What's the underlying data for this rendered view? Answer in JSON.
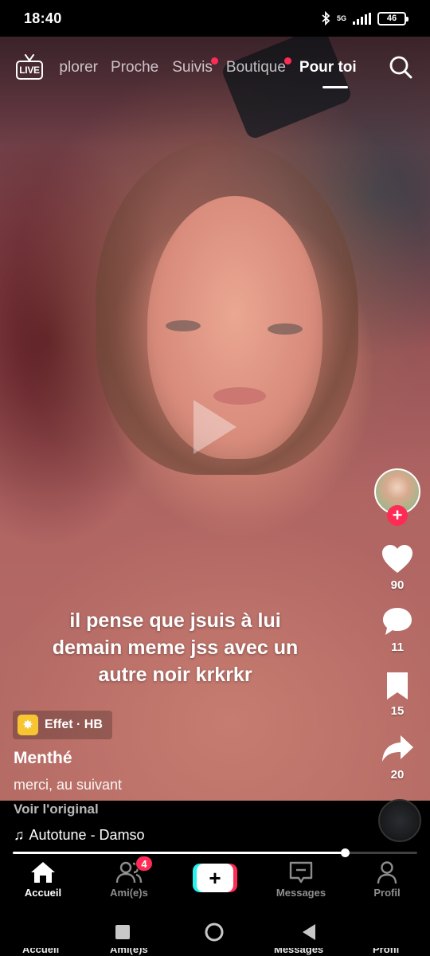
{
  "status_bar": {
    "time": "18:40",
    "network": "5G",
    "battery": "46"
  },
  "top_nav": {
    "live_label": "LIVE",
    "tabs": [
      {
        "label": "Explorer",
        "visible_text": "plorer",
        "active": false,
        "dot": false
      },
      {
        "label": "Proche",
        "active": false,
        "dot": false
      },
      {
        "label": "Suivis",
        "active": false,
        "dot": true
      },
      {
        "label": "Boutique",
        "active": false,
        "dot": true
      },
      {
        "label": "Pour toi",
        "active": true,
        "dot": false
      }
    ]
  },
  "video": {
    "caption_lines": [
      "il pense que jsuis à lui",
      "demain meme jss avec un",
      "autre noir krkrkr"
    ],
    "effect_label": "Effet · HB",
    "username": "Menthé",
    "description": "merci, au suivant",
    "see_original": "Voir l'original",
    "music": "Autotune - Damso",
    "progress": 0.82
  },
  "actions": {
    "likes": "90",
    "comments": "11",
    "saves": "15",
    "shares": "20"
  },
  "bottom_nav": {
    "items": [
      {
        "label": "Accueil",
        "active": true
      },
      {
        "label": "Ami(e)s",
        "active": false,
        "badge": "4"
      },
      {
        "label": "",
        "create": true
      },
      {
        "label": "Messages",
        "active": false
      },
      {
        "label": "Profil",
        "active": false
      }
    ]
  },
  "colors": {
    "accent": "#fe2c55",
    "cyan": "#25f4ee",
    "effect": "#f7c531"
  }
}
